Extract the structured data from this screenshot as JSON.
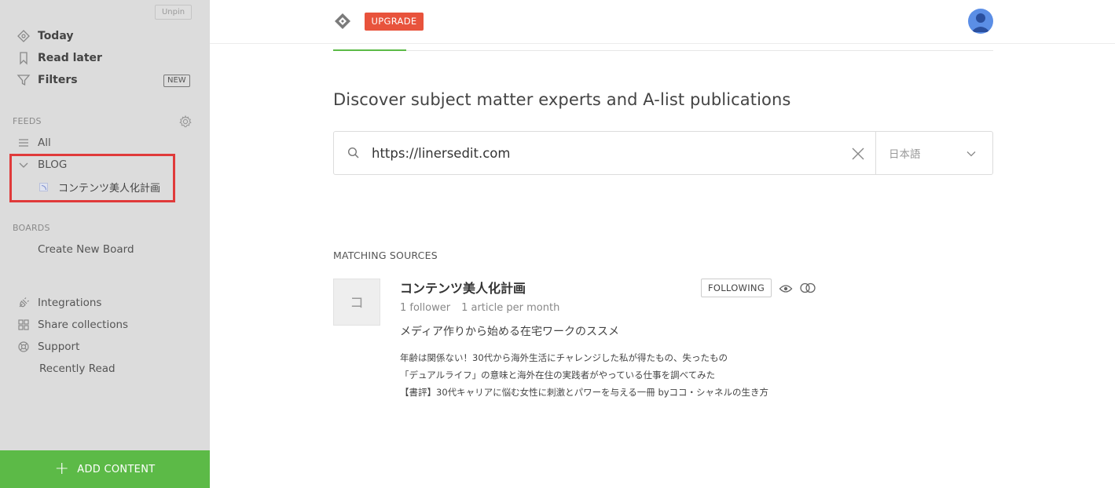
{
  "sidebar": {
    "unpin_label": "Unpin",
    "nav": [
      {
        "label": "Today",
        "icon": "today-icon"
      },
      {
        "label": "Read later",
        "icon": "bookmark-icon"
      },
      {
        "label": "Filters",
        "icon": "filter-icon",
        "badge": "NEW"
      }
    ],
    "feeds_section": "FEEDS",
    "feeds_all": "All",
    "blog_folder": "BLOG",
    "blog_feed": "コンテンツ美人化計画",
    "boards_section": "BOARDS",
    "create_board": "Create New Board",
    "footer_nav": [
      {
        "label": "Integrations",
        "icon": "plug-icon"
      },
      {
        "label": "Share collections",
        "icon": "grid-icon"
      },
      {
        "label": "Support",
        "icon": "lifebuoy-icon"
      },
      {
        "label": "Recently Read"
      }
    ],
    "add_content": "ADD CONTENT"
  },
  "header": {
    "upgrade_label": "UPGRADE"
  },
  "main": {
    "heading": "Discover subject matter experts and A-list publications",
    "search": {
      "value": "https://linersedit.com",
      "language": "日本語"
    },
    "matching_label": "MATCHING SOURCES",
    "source": {
      "thumb_letter": "コ",
      "title": "コンテンツ美人化計画",
      "followers": "1 follower",
      "frequency": "1 article per month",
      "description": "メディア作りから始める在宅ワークのススメ",
      "following_label": "FOLLOWING",
      "articles": [
        "年齢は関係ない！30代から海外生活にチャレンジした私が得たもの、失ったもの",
        "「デュアルライフ」の意味と海外在住の実践者がやっている仕事を調べてみた",
        "【書評】30代キャリアに悩む女性に刺激とパワーを与える一冊 byココ・シャネルの生き方"
      ]
    }
  },
  "colors": {
    "accent_green": "#5cba47",
    "upgrade_red": "#e8533c",
    "highlight_red": "#e03a3a",
    "sidebar_bg": "#dcdcdc"
  }
}
